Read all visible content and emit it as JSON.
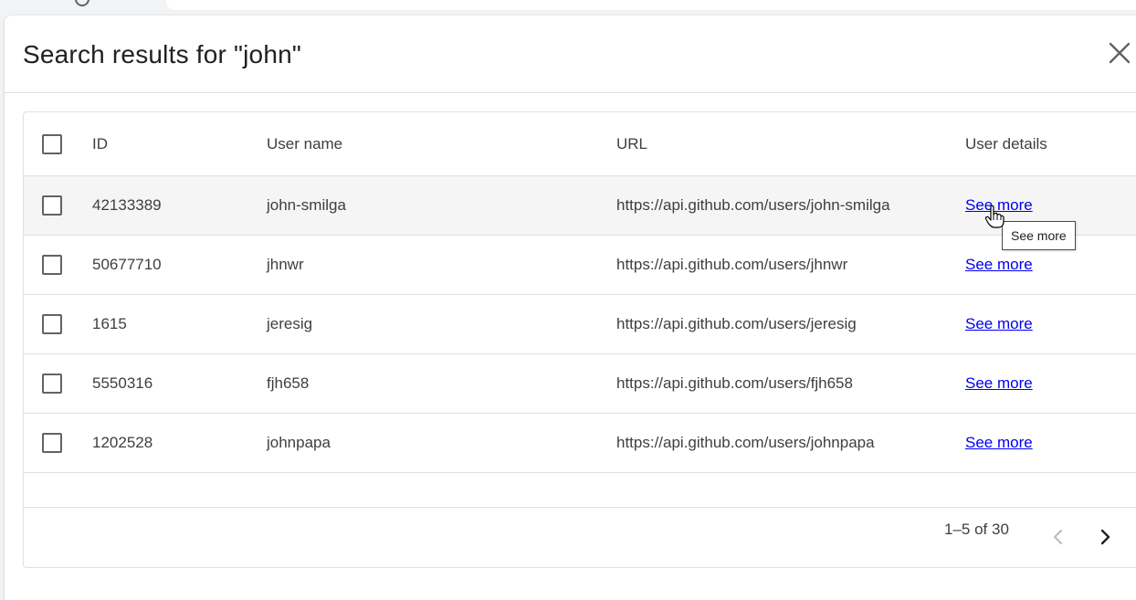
{
  "dialog": {
    "title": "Search results for \"john\""
  },
  "table": {
    "columns": [
      "ID",
      "User name",
      "URL",
      "User details"
    ],
    "rows": [
      {
        "id": "42133389",
        "username": "john-smilga",
        "url": "https://api.github.com/users/john-smilga",
        "details": "See more"
      },
      {
        "id": "50677710",
        "username": "jhnwr",
        "url": "https://api.github.com/users/jhnwr",
        "details": "See more"
      },
      {
        "id": "1615",
        "username": "jeresig",
        "url": "https://api.github.com/users/jeresig",
        "details": "See more"
      },
      {
        "id": "5550316",
        "username": "fjh658",
        "url": "https://api.github.com/users/fjh658",
        "details": "See more"
      },
      {
        "id": "1202528",
        "username": "johnpapa",
        "url": "https://api.github.com/users/johnpapa",
        "details": "See more"
      }
    ],
    "hovered_row": 0
  },
  "pagination": {
    "range": "1–5 of 30"
  },
  "tooltip": {
    "text": "See more"
  },
  "colors": {
    "link": "#0000ee",
    "hover_row": "#f5f5f5",
    "border": "#e0e0e0"
  }
}
